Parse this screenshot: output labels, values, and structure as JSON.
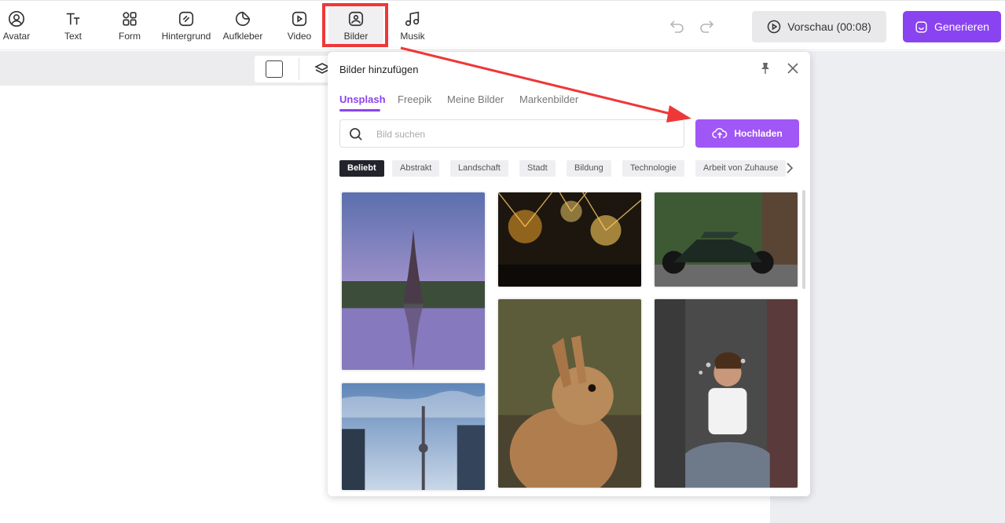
{
  "toolbar": {
    "tools": [
      {
        "label": "Avatar",
        "icon": "user-circle-icon"
      },
      {
        "label": "Text",
        "icon": "text-icon"
      },
      {
        "label": "Form",
        "icon": "shapes-icon"
      },
      {
        "label": "Hintergrund",
        "icon": "background-icon"
      },
      {
        "label": "Aufkleber",
        "icon": "sticker-icon"
      },
      {
        "label": "Video",
        "icon": "video-icon"
      },
      {
        "label": "Bilder",
        "icon": "image-icon"
      },
      {
        "label": "Musik",
        "icon": "music-icon"
      }
    ],
    "active_tool": "Bilder",
    "preview_label": "Vorschau (00:08)",
    "generate_label": "Generieren"
  },
  "panel": {
    "title": "Bilder hinzufügen",
    "tabs": [
      {
        "label": "Unsplash",
        "active": true
      },
      {
        "label": "Freepik",
        "active": false
      },
      {
        "label": "Meine Bilder",
        "active": false
      },
      {
        "label": "Markenbilder",
        "active": false
      }
    ],
    "search_placeholder": "Bild suchen",
    "upload_label": "Hochladen",
    "categories": [
      {
        "label": "Beliebt",
        "active": true
      },
      {
        "label": "Abstrakt",
        "active": false
      },
      {
        "label": "Landschaft",
        "active": false
      },
      {
        "label": "Stadt",
        "active": false
      },
      {
        "label": "Bildung",
        "active": false
      },
      {
        "label": "Technologie",
        "active": false
      },
      {
        "label": "Arbeit von Zuhause",
        "active": false
      }
    ],
    "images": [
      {
        "subject": "eiffel-tower-reflection"
      },
      {
        "subject": "concert-lights"
      },
      {
        "subject": "motorcycle"
      },
      {
        "subject": "rabbit"
      },
      {
        "subject": "girl-blowing-bubbles"
      },
      {
        "subject": "city-tower-skyline"
      }
    ]
  },
  "colors": {
    "accent": "#8a43f0",
    "upload": "#a057f5",
    "highlight": "#ee3838"
  }
}
